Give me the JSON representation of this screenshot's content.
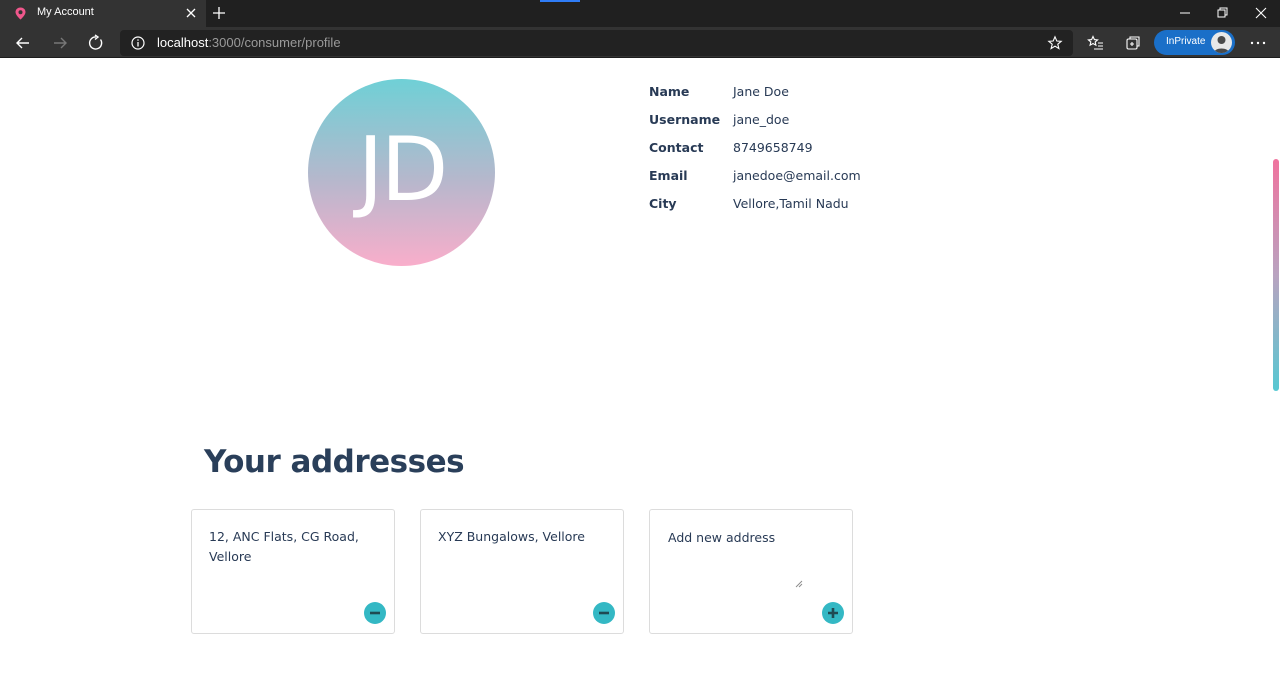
{
  "browser": {
    "tab_title": "My Account",
    "url_host": "localhost",
    "url_rest": ":3000/consumer/profile",
    "inprivate_label": "InPrivate",
    "favicon_color": "#f0578c",
    "accent_color": "#2f7cf6"
  },
  "profile": {
    "initials": "JD",
    "fields": [
      {
        "label": "Name",
        "value": "Jane Doe"
      },
      {
        "label": "Username",
        "value": "jane_doe"
      },
      {
        "label": "Contact",
        "value": "8749658749"
      },
      {
        "label": "Email",
        "value": "janedoe@email.com"
      },
      {
        "label": "City",
        "value": "Vellore,Tamil Nadu"
      }
    ]
  },
  "addresses": {
    "title": "Your addresses",
    "items": [
      {
        "text": "12, ANC Flats, CG Road, Vellore",
        "action_icon": "minus-circle-icon"
      },
      {
        "text": "XYZ Bungalows, Vellore",
        "action_icon": "minus-circle-icon"
      }
    ],
    "new_address_placeholder": "Add new address",
    "add_icon": "plus-circle-icon"
  },
  "theme": {
    "heading_color": "#2a3f5a",
    "text_color": "#283a55",
    "button_color": "#34b8c4"
  }
}
